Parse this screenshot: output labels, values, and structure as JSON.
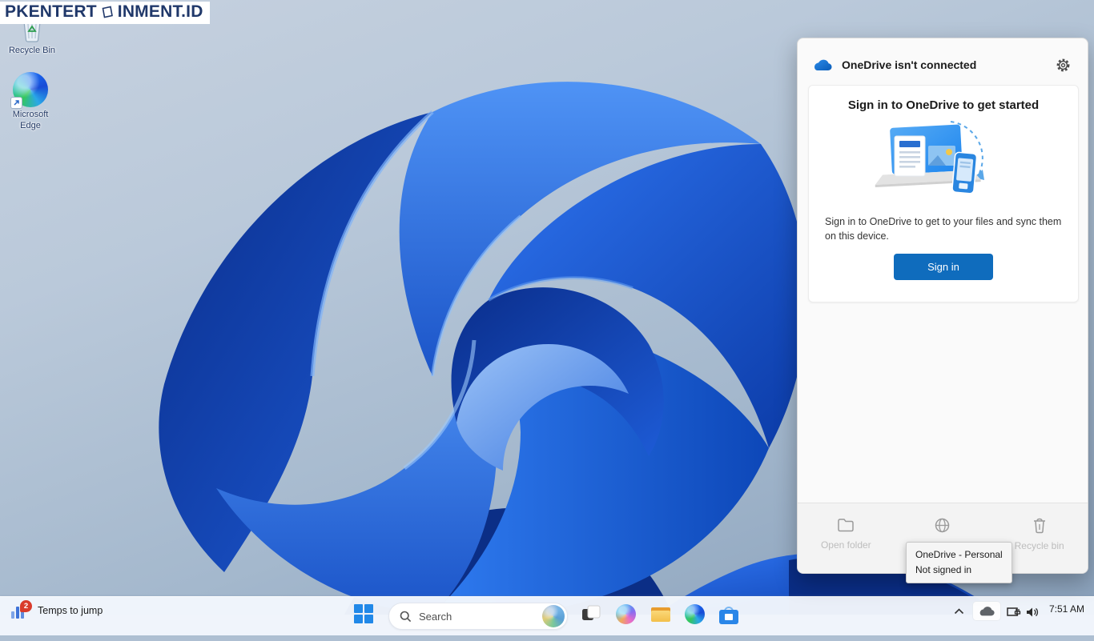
{
  "watermark": {
    "prefix": "PKENTERT",
    "suffix": "INMENT.ID"
  },
  "desktop": {
    "icons": [
      {
        "label": "Recycle Bin"
      },
      {
        "label": "Microsoft Edge"
      }
    ]
  },
  "onedrive": {
    "title": "OneDrive isn't connected",
    "heading": "Sign in to OneDrive to get started",
    "body": "Sign in to OneDrive to get to your files and sync them on this device.",
    "signin_label": "Sign in",
    "footer": {
      "open_folder": "Open folder",
      "recycle_bin": "Recycle bin"
    },
    "tooltip": {
      "line1": "OneDrive - Personal",
      "line2": "Not signed in"
    }
  },
  "taskbar": {
    "widget": {
      "label": "Temps to jump",
      "badge": "2"
    },
    "search": {
      "placeholder": "Search"
    },
    "clock": {
      "time": "7:51 AM"
    }
  },
  "colors": {
    "accent_blue": "#0f6cbd",
    "onedrive_cloud_blue": "#0d6cbe",
    "watermark_navy": "#20386a",
    "wallpaper_deep_blue": "#0b2f8c"
  }
}
